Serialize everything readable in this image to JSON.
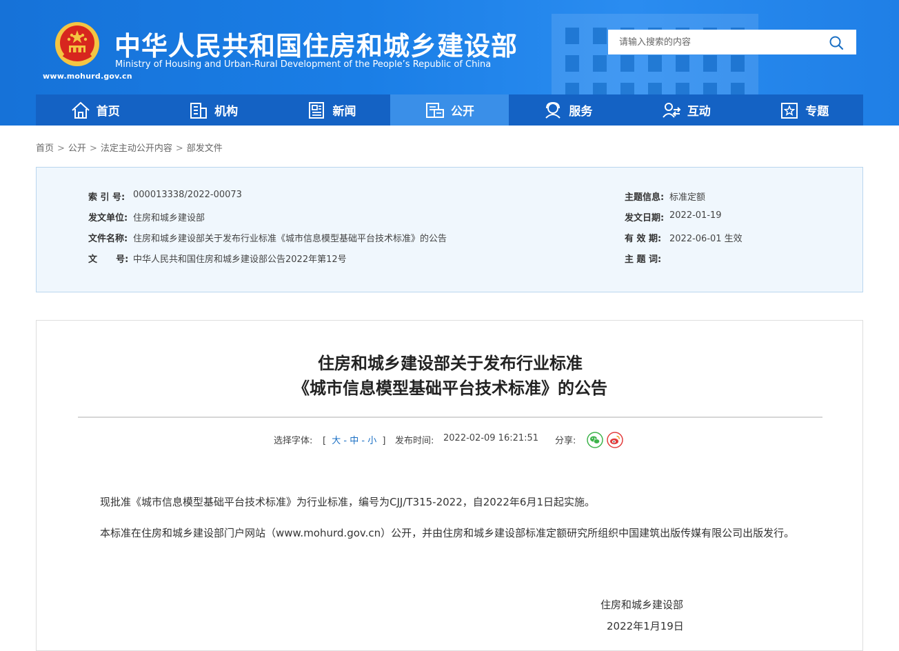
{
  "header": {
    "site_url": "www.mohurd.gov.cn",
    "title_cn": "中华人民共和国住房和城乡建设部",
    "title_en": "Ministry of Housing and Urban-Rural Development of the People’s Republic of China",
    "search_placeholder": "请输入搜索的内容",
    "brand_blue": "#1a7ee6",
    "nav_blue": "#1462c4",
    "nav_active": "#3a8fe8"
  },
  "nav": {
    "items": [
      {
        "label": "首页",
        "icon": "home-icon"
      },
      {
        "label": "机构",
        "icon": "building-icon"
      },
      {
        "label": "新闻",
        "icon": "news-icon"
      },
      {
        "label": "公开",
        "icon": "disclosure-icon",
        "active": true
      },
      {
        "label": "服务",
        "icon": "service-icon"
      },
      {
        "label": "互动",
        "icon": "interaction-icon"
      },
      {
        "label": "专题",
        "icon": "topic-icon"
      }
    ]
  },
  "breadcrumb": {
    "items": [
      "首页",
      "公开",
      "法定主动公开内容",
      "部发文件"
    ],
    "separator": ">"
  },
  "info": {
    "index_label": "索 引 号:",
    "index_value": "000013338/2022-00073",
    "issuer_label": "发文单位:",
    "issuer_value": "住房和城乡建设部",
    "filename_label": "文件名称:",
    "filename_value": "住房和城乡建设部关于发布行业标准《城市信息模型基础平台技术标准》的公告",
    "docno_label": "文      号:",
    "docno_value": "中华人民共和国住房和城乡建设部公告2022年第12号",
    "topic_label": "主题信息:",
    "topic_value": "标准定额",
    "date_label": "发文日期:",
    "date_value": "2022-01-19",
    "validity_label": "有 效 期:",
    "validity_value": "2022-06-01 生效",
    "keywords_label": "主 题 词:",
    "keywords_value": ""
  },
  "article": {
    "title_line1": "住房和城乡建设部关于发布行业标准",
    "title_line2": "《城市信息模型基础平台技术标准》的公告",
    "font_select_label": "选择字体:",
    "font_bracket_open": "[",
    "font_large": "大",
    "font_dash": "-",
    "font_medium": "中",
    "font_small": "小",
    "font_bracket_close": "]",
    "publish_label": "发布时间:",
    "publish_time": "2022-02-09 16:21:51",
    "share_label": "分享:",
    "para1": "现批准《城市信息模型基础平台技术标准》为行业标准，编号为CJJ/T315-2022，自2022年6月1日起实施。",
    "para2": "本标准在住房和城乡建设部门户网站（www.mohurd.gov.cn）公开，并由住房和城乡建设部标准定额研究所组织中国建筑出版传媒有限公司出版发行。",
    "sign_org": "住房和城乡建设部",
    "sign_date": "2022年1月19日"
  }
}
